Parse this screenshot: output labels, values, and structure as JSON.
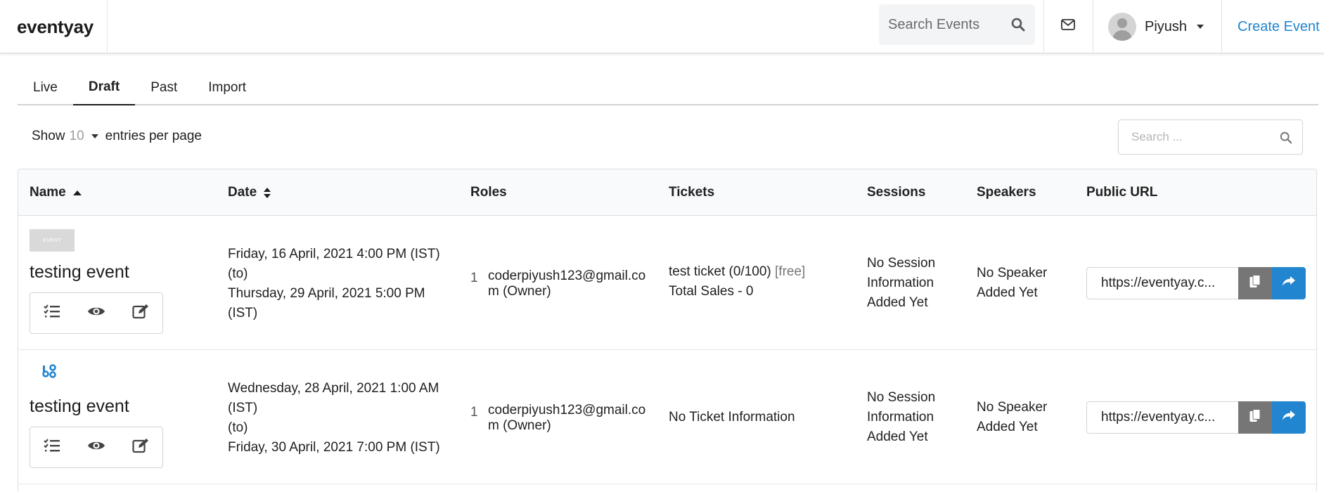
{
  "navbar": {
    "brand": "eventyay",
    "search_placeholder": "Search Events",
    "user_name": "Piyush",
    "create_event": "Create Event"
  },
  "tabs": [
    {
      "label": "Live",
      "active": false
    },
    {
      "label": "Draft",
      "active": true
    },
    {
      "label": "Past",
      "active": false
    },
    {
      "label": "Import",
      "active": false
    }
  ],
  "controls": {
    "show_label": "Show",
    "entries_count": "10",
    "entries_suffix": "entries per page",
    "search_placeholder": "Search ..."
  },
  "table": {
    "columns": [
      "Name",
      "Date",
      "Roles",
      "Tickets",
      "Sessions",
      "Speakers",
      "Public URL"
    ],
    "rows": [
      {
        "thumb_text": "EVENT",
        "name": "testing event",
        "date_start": "Friday, 16 April, 2021 4:00 PM (IST)",
        "date_to": "(to)",
        "date_end": "Thursday, 29 April, 2021 5:00 PM (IST)",
        "role_num": "1",
        "role_email": "coderpiyush123@gmail.com (Owner)",
        "ticket_line": "test ticket (0/100)",
        "ticket_free": "[free]",
        "ticket_sales": "Total Sales - 0",
        "sessions": "No Session Information Added Yet",
        "speakers": "No Speaker Added Yet",
        "public_url": "https://eventyay.c..."
      },
      {
        "thumb_text": "",
        "name": "testing event",
        "date_start": "Wednesday, 28 April, 2021 1:00 AM (IST)",
        "date_to": "(to)",
        "date_end": "Friday, 30 April, 2021 7:00 PM (IST)",
        "role_num": "1",
        "role_email": "coderpiyush123@gmail.com (Owner)",
        "ticket_line": "No Ticket Information",
        "ticket_free": "",
        "ticket_sales": "",
        "sessions": "No Session Information Added Yet",
        "speakers": "No Speaker Added Yet",
        "public_url": "https://eventyay.c..."
      }
    ]
  },
  "colors": {
    "accent": "#2185d0",
    "copy_button": "#767676",
    "header_bg": "#f9fafb"
  }
}
